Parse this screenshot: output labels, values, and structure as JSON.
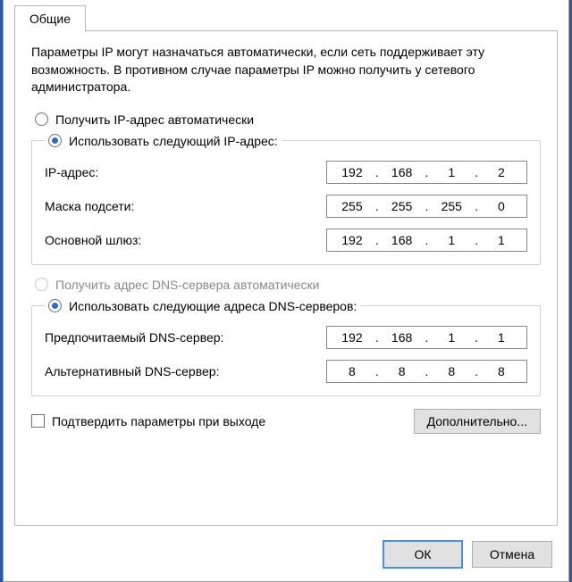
{
  "tab": "Общие",
  "description": "Параметры IP могут назначаться автоматически, если сеть поддерживает эту возможность. В противном случае параметры IP можно получить у сетевого администратора.",
  "ip_section": {
    "auto_label": "Получить IP-адрес автоматически",
    "manual_label": "Использовать следующий IP-адрес:",
    "fields": {
      "ip": {
        "label": "IP-адрес:",
        "value": [
          "192",
          "168",
          "1",
          "2"
        ]
      },
      "mask": {
        "label": "Маска подсети:",
        "value": [
          "255",
          "255",
          "255",
          "0"
        ]
      },
      "gateway": {
        "label": "Основной шлюз:",
        "value": [
          "192",
          "168",
          "1",
          "1"
        ]
      }
    }
  },
  "dns_section": {
    "auto_label": "Получить адрес DNS-сервера автоматически",
    "manual_label": "Использовать следующие адреса DNS-серверов:",
    "fields": {
      "preferred": {
        "label": "Предпочитаемый DNS-сервер:",
        "value": [
          "192",
          "168",
          "1",
          "1"
        ]
      },
      "alternate": {
        "label": "Альтернативный DNS-сервер:",
        "value": [
          "8",
          "8",
          "8",
          "8"
        ]
      }
    }
  },
  "validate_label": "Подтвердить параметры при выходе",
  "advanced_label": "Дополнительно...",
  "ok_label": "ОК",
  "cancel_label": "Отмена"
}
